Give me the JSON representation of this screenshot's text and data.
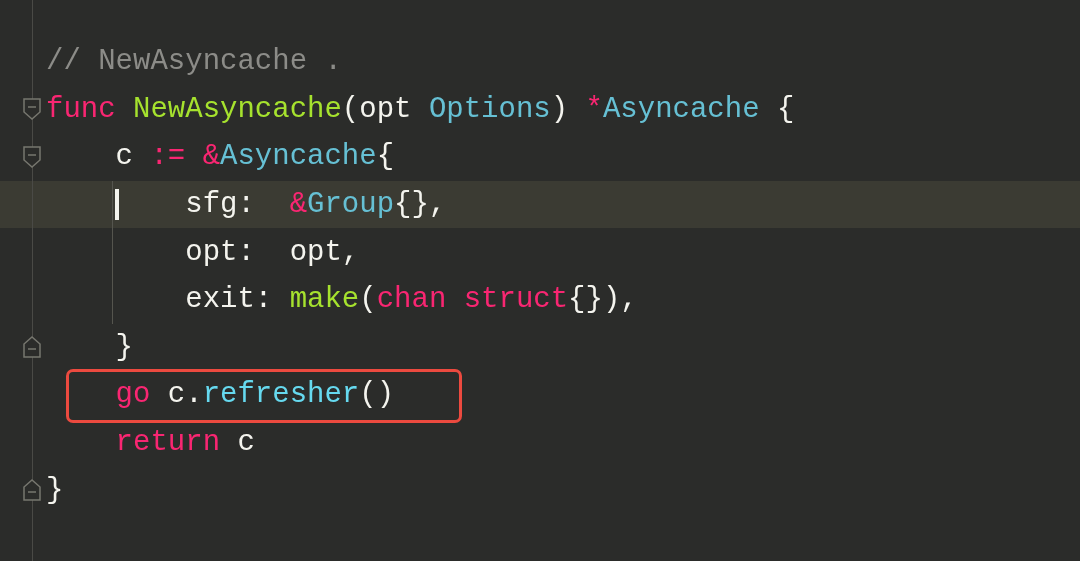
{
  "editor": {
    "lines": [
      {
        "tokens": [
          {
            "text": "// NewAsyncache .",
            "kind": "comment"
          }
        ]
      },
      {
        "fold_start": true,
        "tokens": [
          {
            "text": "func ",
            "kind": "keyword"
          },
          {
            "text": "NewAsyncache",
            "kind": "func"
          },
          {
            "text": "(opt ",
            "kind": "plain"
          },
          {
            "text": "Options",
            "kind": "type"
          },
          {
            "text": ") ",
            "kind": "plain"
          },
          {
            "text": "*",
            "kind": "keyword"
          },
          {
            "text": "Asyncache",
            "kind": "type"
          },
          {
            "text": " {",
            "kind": "plain"
          }
        ]
      },
      {
        "fold_start": true,
        "tokens": [
          {
            "text": "    c ",
            "kind": "plain"
          },
          {
            "text": ":= &",
            "kind": "keyword"
          },
          {
            "text": "Asyncache",
            "kind": "type"
          },
          {
            "text": "{",
            "kind": "plain"
          }
        ]
      },
      {
        "highlighted": true,
        "cursor": true,
        "guide": true,
        "tokens": [
          {
            "text": "        sfg:  ",
            "kind": "plain"
          },
          {
            "text": "&",
            "kind": "keyword"
          },
          {
            "text": "Group",
            "kind": "type"
          },
          {
            "text": "{},",
            "kind": "plain"
          }
        ]
      },
      {
        "guide": true,
        "tokens": [
          {
            "text": "        opt:  opt,",
            "kind": "plain"
          }
        ]
      },
      {
        "guide": true,
        "tokens": [
          {
            "text": "        exit: ",
            "kind": "plain"
          },
          {
            "text": "make",
            "kind": "func"
          },
          {
            "text": "(",
            "kind": "plain"
          },
          {
            "text": "chan struct",
            "kind": "keyword"
          },
          {
            "text": "{}),",
            "kind": "plain"
          }
        ]
      },
      {
        "fold_end": true,
        "tokens": [
          {
            "text": "    }",
            "kind": "plain"
          }
        ]
      },
      {
        "boxed": true,
        "tokens": [
          {
            "text": "    go",
            "kind": "keyword"
          },
          {
            "text": " c.",
            "kind": "plain"
          },
          {
            "text": "refresher",
            "kind": "call"
          },
          {
            "text": "()",
            "kind": "plain"
          }
        ]
      },
      {
        "tokens": [
          {
            "text": "    return",
            "kind": "keyword"
          },
          {
            "text": " c",
            "kind": "plain"
          }
        ]
      },
      {
        "fold_end": true,
        "tokens": [
          {
            "text": "}",
            "kind": "plain"
          }
        ]
      }
    ]
  }
}
